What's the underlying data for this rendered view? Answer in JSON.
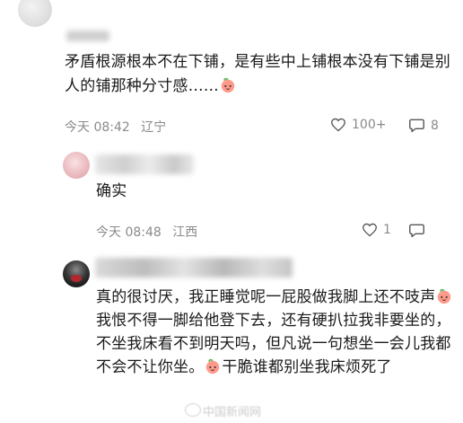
{
  "comments": [
    {
      "text_a": "矛盾根源根本不在下铺，是有些中上铺根本没有下铺是别人的铺那种分寸感……",
      "time": "今天 08:42",
      "location": "辽宁",
      "likes": "100+",
      "replies": "8"
    },
    {
      "text_a": "确实",
      "time": "今天 08:48",
      "location": "江西",
      "likes": "1",
      "replies": ""
    },
    {
      "text_a": "真的很讨厌，我正睡觉呢一屁股做我脚上还不吱声",
      "text_b": "我恨不得一脚给他登下去，还有硬扒拉我非要坐的，不坐我床看不到明天吗，但凡说一句想坐一会儿我都不会不让你坐。",
      "text_c": "干脆谁都别坐我床烦死了"
    }
  ],
  "watermark": "中国新闻网",
  "icons": {
    "like": "heart-outline-icon",
    "reply": "comment-bubble-icon",
    "emoji": "peach-face-emoji"
  }
}
